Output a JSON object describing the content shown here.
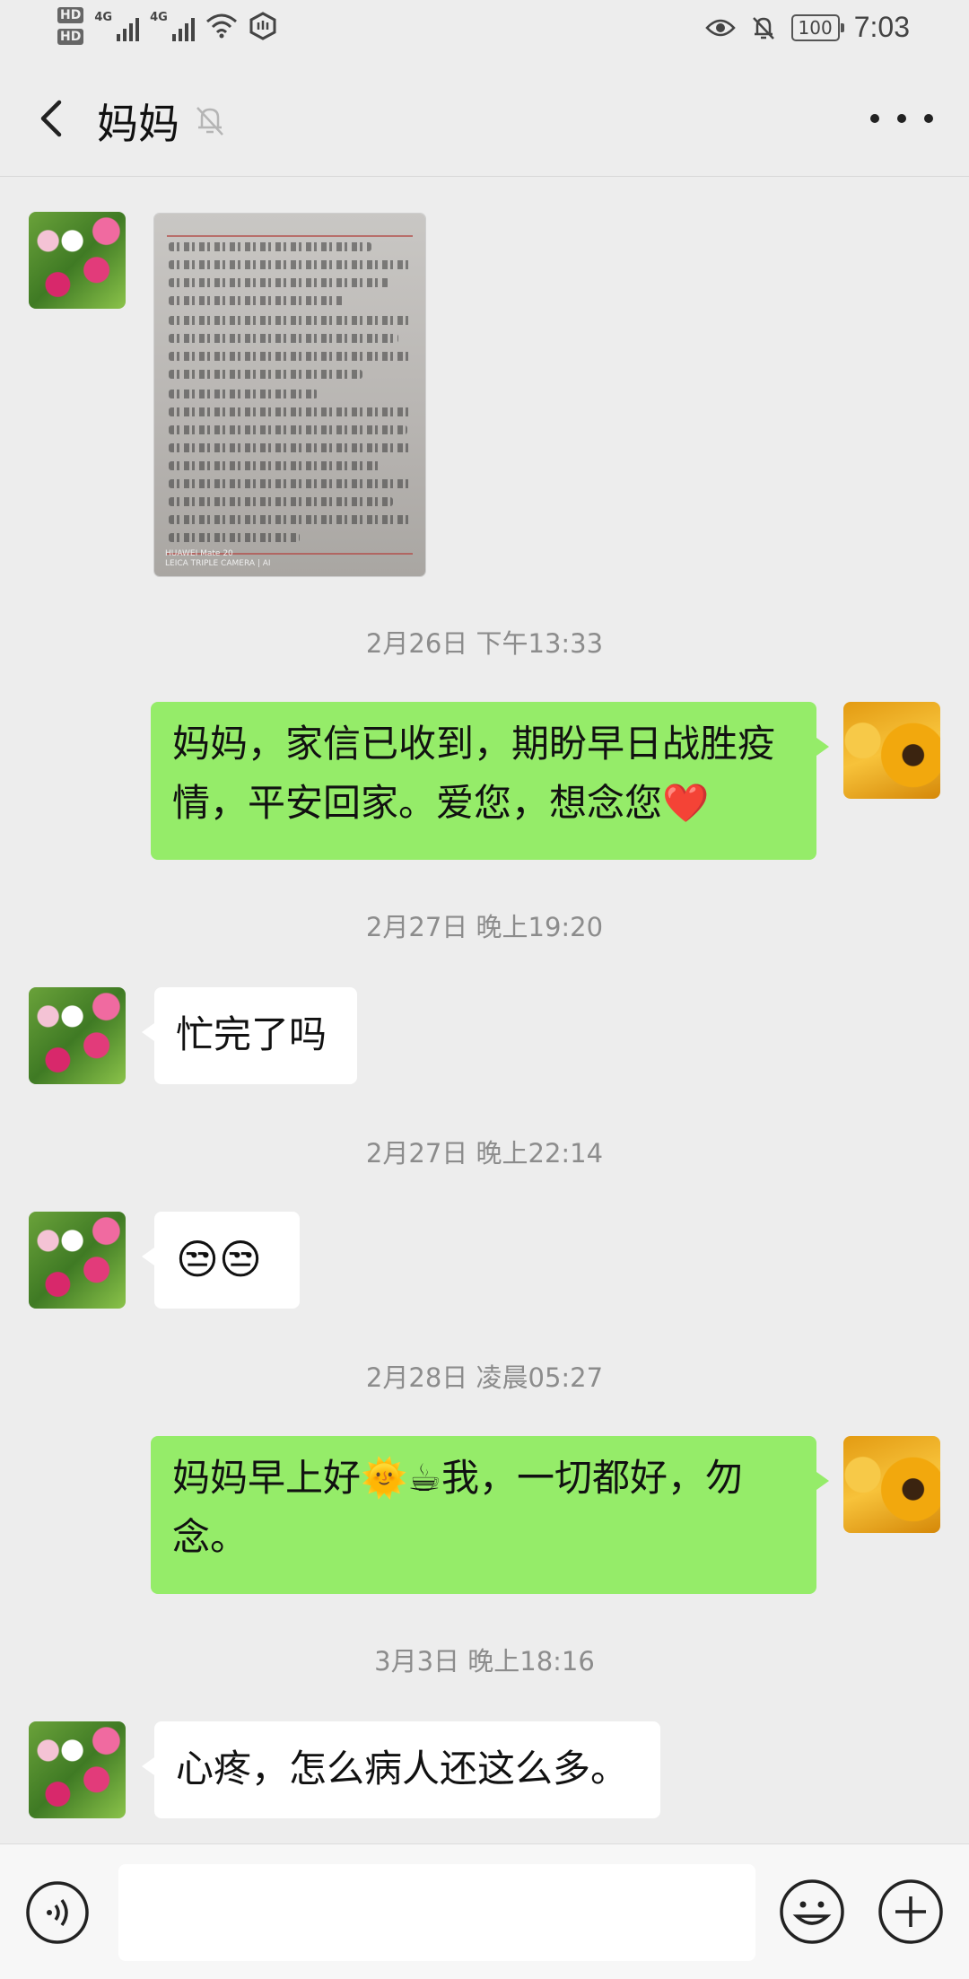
{
  "status_bar": {
    "hd1": "HD",
    "hd2": "HD",
    "net1": "4G",
    "net2": "4G",
    "battery": "100",
    "time": "7:03"
  },
  "header": {
    "title": "妈妈",
    "back_icon": "chevron-left-icon",
    "mute_icon": "bell-off-icon",
    "more_icon": "more-dots-icon"
  },
  "letter_image": {
    "camera_caption": "HUAWEI Mate 20\nLEICA TRIPLE CAMERA | AI"
  },
  "messages": [
    {
      "kind": "image",
      "side": "left"
    },
    {
      "kind": "timestamp",
      "text": "2月26日 下午13:33"
    },
    {
      "kind": "text",
      "side": "right",
      "text": "妈妈，家信已收到，期盼早日战胜疫情，平安回家。爱您，想念您❤️"
    },
    {
      "kind": "timestamp",
      "text": "2月27日 晚上19:20"
    },
    {
      "kind": "text",
      "side": "left",
      "text": "忙完了吗"
    },
    {
      "kind": "timestamp",
      "text": "2月27日 晚上22:14"
    },
    {
      "kind": "text",
      "side": "left",
      "text": "😒😒"
    },
    {
      "kind": "timestamp",
      "text": "2月28日 凌晨05:27"
    },
    {
      "kind": "text",
      "side": "right",
      "text": "妈妈早上好🌞☕我，一切都好，勿念。"
    },
    {
      "kind": "timestamp",
      "text": "3月3日 晚上18:16"
    },
    {
      "kind": "text",
      "side": "left",
      "text": "心疼，怎么病人还这么多。"
    }
  ],
  "input_bar": {
    "voice_icon": "voice-icon",
    "emoji_icon": "smiley-icon",
    "plus_icon": "plus-circle-icon",
    "text": ""
  },
  "colors": {
    "background": "#ededed",
    "self_bubble": "#95ec69",
    "other_bubble": "#ffffff",
    "timestamp": "#8c8c8c"
  }
}
